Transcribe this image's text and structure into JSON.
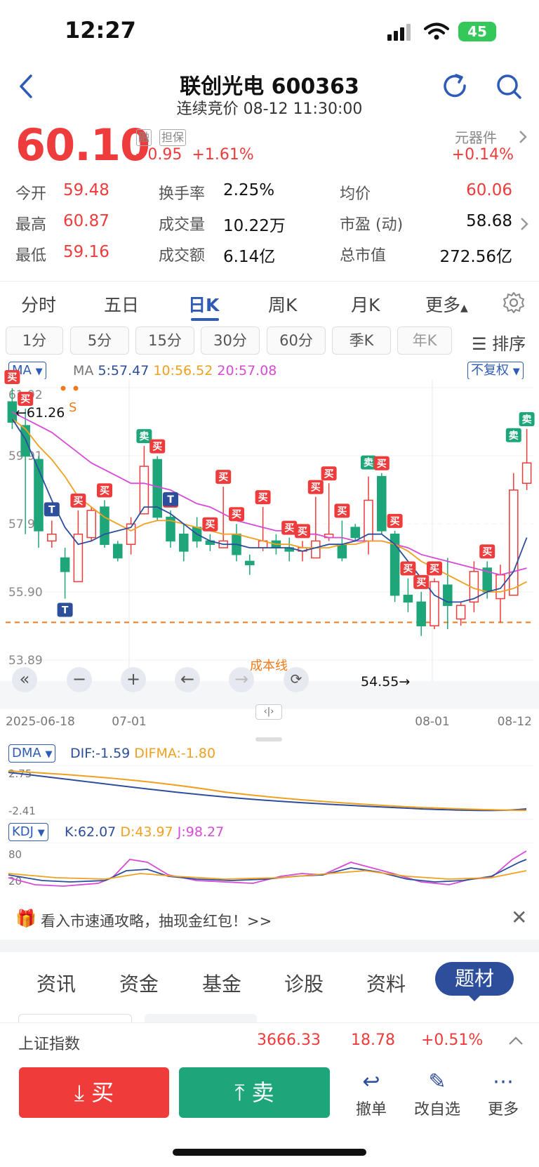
{
  "status_bar": {
    "time": "12:27",
    "battery": "45"
  },
  "header": {
    "title": "联创光电 600363",
    "subtitle": "连续竞价 08-12 11:30:00"
  },
  "quote": {
    "price": "60.10",
    "tag1": "融",
    "tag2": "担保",
    "change": "+0.95",
    "change_pct": "+1.61%",
    "sector": "元器件",
    "sector_change": "+0.14%",
    "rows": [
      [
        {
          "label": "今开",
          "value": "59.48",
          "tone": "red"
        },
        {
          "label": "换手率",
          "value": "2.25%",
          "tone": "black"
        },
        {
          "label": "均价",
          "value": "60.06",
          "tone": "red"
        }
      ],
      [
        {
          "label": "最高",
          "value": "60.87",
          "tone": "red"
        },
        {
          "label": "成交量",
          "value": "10.22万",
          "tone": "black"
        },
        {
          "label": "市盈 (动)",
          "value": "58.68",
          "tone": "black"
        }
      ],
      [
        {
          "label": "最低",
          "value": "59.16",
          "tone": "red"
        },
        {
          "label": "成交额",
          "value": "6.14亿",
          "tone": "black"
        },
        {
          "label": "总市值",
          "value": "272.56亿",
          "tone": "black"
        }
      ]
    ]
  },
  "chart_tabs": [
    "分时",
    "五日",
    "日K",
    "周K",
    "月K",
    "更多"
  ],
  "chart_tab_active": "日K",
  "periods": [
    "1分",
    "5分",
    "15分",
    "30分",
    "60分",
    "季K",
    "年K"
  ],
  "sort_label": "排序",
  "ma_bar": {
    "selector": "MA",
    "prefix": "MA",
    "ma5": "5:57.47",
    "ma10": "10:56.52",
    "ma20": "20:57.08",
    "adjust": "不复权"
  },
  "kline": {
    "y_labels": [
      "61.92",
      "59.91",
      "57.90",
      "55.90",
      "53.89"
    ],
    "x_labels": [
      "2025-06-18",
      "07-01",
      "08-01",
      "08-12"
    ],
    "high_marker": "←61.26",
    "low_marker": "54.55→",
    "cost_line_label": "成本线",
    "s_marker": "S",
    "buy_label": "买",
    "sell_label": "卖",
    "t_label": "T"
  },
  "chart_data": {
    "type": "candlestick",
    "ylim": [
      53.89,
      61.92
    ],
    "x_ticks": [
      "2025-06-18",
      "07-01",
      "08-01",
      "08-12"
    ],
    "candles": [
      {
        "o": 61.5,
        "c": 60.9,
        "h": 61.9,
        "l": 60.7
      },
      {
        "o": 60.8,
        "c": 59.9,
        "h": 61.3,
        "l": 57.6
      },
      {
        "o": 59.8,
        "c": 57.7,
        "h": 59.9,
        "l": 57.2
      },
      {
        "o": 57.4,
        "c": 57.6,
        "h": 58.0,
        "l": 57.2
      },
      {
        "o": 56.9,
        "c": 56.5,
        "h": 57.2,
        "l": 55.7
      },
      {
        "o": 56.2,
        "c": 57.6,
        "h": 58.3,
        "l": 56.2
      },
      {
        "o": 57.5,
        "c": 58.3,
        "h": 58.4,
        "l": 57.4
      },
      {
        "o": 58.4,
        "c": 57.3,
        "h": 58.6,
        "l": 57.2
      },
      {
        "o": 57.3,
        "c": 56.9,
        "h": 57.4,
        "l": 56.8
      },
      {
        "o": 57.3,
        "c": 57.9,
        "h": 58.1,
        "l": 57.0
      },
      {
        "o": 58.2,
        "c": 59.6,
        "h": 60.2,
        "l": 58.2
      },
      {
        "o": 59.8,
        "c": 58.1,
        "h": 59.9,
        "l": 58.0
      },
      {
        "o": 58.1,
        "c": 57.4,
        "h": 58.3,
        "l": 57.2
      },
      {
        "o": 57.6,
        "c": 57.1,
        "h": 57.9,
        "l": 56.8
      },
      {
        "o": 57.8,
        "c": 57.4,
        "h": 58.1,
        "l": 57.2
      },
      {
        "o": 57.4,
        "c": 57.3,
        "h": 57.6,
        "l": 57.1
      },
      {
        "o": 57.2,
        "c": 57.4,
        "h": 59.0,
        "l": 57.2
      },
      {
        "o": 57.6,
        "c": 57.0,
        "h": 57.9,
        "l": 56.8
      },
      {
        "o": 56.8,
        "c": 56.7,
        "h": 57.0,
        "l": 56.4
      },
      {
        "o": 57.2,
        "c": 57.4,
        "h": 58.4,
        "l": 57.1
      },
      {
        "o": 57.4,
        "c": 57.2,
        "h": 57.6,
        "l": 57.0
      },
      {
        "o": 57.2,
        "c": 57.1,
        "h": 57.5,
        "l": 56.8
      },
      {
        "o": 57.1,
        "c": 57.2,
        "h": 57.4,
        "l": 56.8
      },
      {
        "o": 56.9,
        "c": 57.4,
        "h": 58.7,
        "l": 56.9
      },
      {
        "o": 57.5,
        "c": 57.6,
        "h": 59.1,
        "l": 57.4
      },
      {
        "o": 57.3,
        "c": 56.9,
        "h": 58.0,
        "l": 56.8
      },
      {
        "o": 57.8,
        "c": 57.5,
        "h": 57.9,
        "l": 57.4
      },
      {
        "o": 57.4,
        "c": 58.6,
        "h": 59.3,
        "l": 57.0
      },
      {
        "o": 59.3,
        "c": 57.7,
        "h": 59.4,
        "l": 57.6
      },
      {
        "o": 57.6,
        "c": 55.8,
        "h": 57.7,
        "l": 55.6
      },
      {
        "o": 55.8,
        "c": 55.6,
        "h": 56.3,
        "l": 55.3
      },
      {
        "o": 55.6,
        "c": 54.9,
        "h": 55.9,
        "l": 54.6
      },
      {
        "o": 54.9,
        "c": 56.2,
        "h": 56.3,
        "l": 54.8
      },
      {
        "o": 56.1,
        "c": 55.5,
        "h": 56.9,
        "l": 54.8
      },
      {
        "o": 55.1,
        "c": 55.5,
        "h": 55.6,
        "l": 54.9
      },
      {
        "o": 55.6,
        "c": 56.5,
        "h": 56.8,
        "l": 55.3
      },
      {
        "o": 56.6,
        "c": 55.9,
        "h": 56.8,
        "l": 55.7
      },
      {
        "o": 55.7,
        "c": 56.4,
        "h": 56.7,
        "l": 55.0
      },
      {
        "o": 55.8,
        "c": 58.9,
        "h": 59.4,
        "l": 55.8
      },
      {
        "o": 59.1,
        "c": 59.7,
        "h": 60.7,
        "l": 58.9
      }
    ],
    "ma5": [
      61.0,
      60.4,
      59.5,
      58.6,
      57.8,
      57.3,
      57.4,
      57.6,
      57.7,
      57.8,
      58.4,
      58.4,
      58.2,
      57.9,
      57.6,
      57.4,
      57.3,
      57.3,
      57.2,
      57.2,
      57.2,
      57.2,
      57.1,
      57.2,
      57.3,
      57.3,
      57.4,
      57.6,
      57.6,
      57.3,
      56.8,
      56.3,
      55.8,
      55.6,
      55.6,
      55.7,
      55.9,
      56.0,
      56.5,
      57.5
    ],
    "ma10": [
      61.0,
      60.7,
      60.2,
      59.8,
      59.3,
      58.7,
      58.4,
      58.1,
      57.9,
      57.7,
      57.9,
      58.0,
      58.0,
      57.9,
      57.8,
      57.7,
      57.6,
      57.6,
      57.5,
      57.4,
      57.3,
      57.3,
      57.2,
      57.2,
      57.2,
      57.3,
      57.3,
      57.4,
      57.4,
      57.3,
      57.1,
      56.8,
      56.6,
      56.4,
      56.2,
      56.0,
      55.9,
      55.9,
      56.0,
      56.2
    ],
    "ma20": [
      61.2,
      61.0,
      60.8,
      60.6,
      60.3,
      60.0,
      59.7,
      59.5,
      59.3,
      59.1,
      59.1,
      59.0,
      58.9,
      58.7,
      58.5,
      58.4,
      58.2,
      58.0,
      57.9,
      57.8,
      57.7,
      57.7,
      57.6,
      57.6,
      57.5,
      57.5,
      57.4,
      57.4,
      57.4,
      57.3,
      57.2,
      57.0,
      56.9,
      56.8,
      56.7,
      56.6,
      56.5,
      56.4,
      56.5,
      56.6
    ],
    "cost_line": 55.0,
    "dma": {
      "dif": "-1.59",
      "difma": "-1.80",
      "y_top": "2.75",
      "y_bottom": "-2.41"
    },
    "kdj": {
      "k": "62.07",
      "d": "43.97",
      "j": "98.27",
      "y_top": "80",
      "y_bottom": "20"
    }
  },
  "dma_bar": {
    "selector": "DMA",
    "dif": "DIF:-1.59",
    "difma": "DIFMA:-1.80",
    "y_top": "2.75",
    "y_bottom": "-2.41"
  },
  "kdj_bar": {
    "selector": "KDJ",
    "k": "K:62.07",
    "d": "D:43.97",
    "j": "J:98.27",
    "y_top": "80",
    "y_bottom": "20"
  },
  "banner": {
    "text": "看入市速通攻略，抽现金红包！>>"
  },
  "bottom_tabs": [
    "资讯",
    "资金",
    "基金",
    "诊股",
    "资料"
  ],
  "bottom_tab_active": "题材",
  "index_bar": {
    "name": "上证指数",
    "value": "3666.33",
    "change": "18.78",
    "change_pct": "+0.51%"
  },
  "actions": {
    "buy": "买",
    "sell": "卖",
    "cancel": "撤单",
    "watchlist": "改自选",
    "more": "更多"
  },
  "colors": {
    "up": "#ee3b3b",
    "down": "#1ea67a",
    "accent": "#2d5bb5",
    "ma5": "#2d4e9b",
    "ma10": "#f0a020",
    "ma20": "#d64bd6",
    "cost": "#f07a1e"
  }
}
